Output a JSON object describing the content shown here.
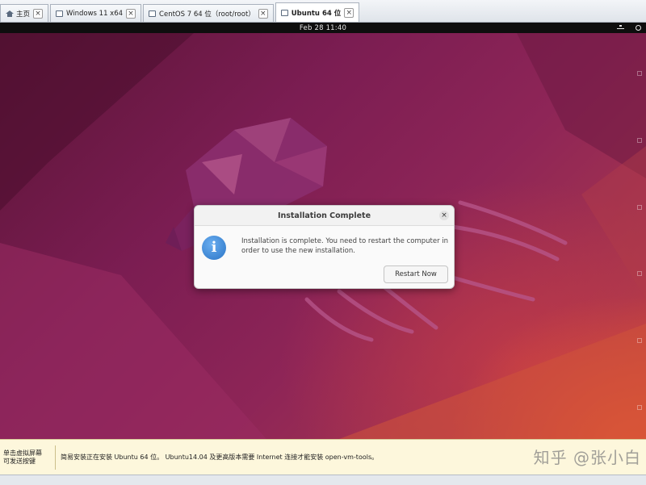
{
  "vmware": {
    "tabs": [
      {
        "label": "主页",
        "icon": "home-icon",
        "active": false
      },
      {
        "label": "Windows 11 x64",
        "icon": "vm-icon",
        "active": false
      },
      {
        "label": "CentOS 7 64 位（root/root）",
        "icon": "vm-icon",
        "active": false
      },
      {
        "label": "Ubuntu 64 位",
        "icon": "vm-icon",
        "active": true
      }
    ],
    "close_glyph": "×",
    "hint_left": [
      "单击虚拟屏幕",
      "可发送按键"
    ],
    "hint_message": "简易安装正在安装 Ubuntu 64 位。 Ubuntu14.04 及更高版本需要 Internet 连接才能安装 open-vm-tools。"
  },
  "ubuntu": {
    "clock": "Feb 28  11:40",
    "tray_icons": [
      "network-icon",
      "power-icon"
    ]
  },
  "dialog": {
    "title": "Installation Complete",
    "close_glyph": "×",
    "icon": "info-icon",
    "icon_glyph": "i",
    "message": "Installation is complete. You need to restart the computer in order to use the new installation.",
    "restart_label": "Restart Now"
  },
  "watermark": "知乎 @张小白",
  "colors": {
    "wallpaper_dark": "#5a1436",
    "wallpaper_mid": "#8e2557",
    "wallpaper_orange": "#c84934",
    "info_blue": "#2a74c6",
    "hint_bg": "#fdf7dc"
  }
}
